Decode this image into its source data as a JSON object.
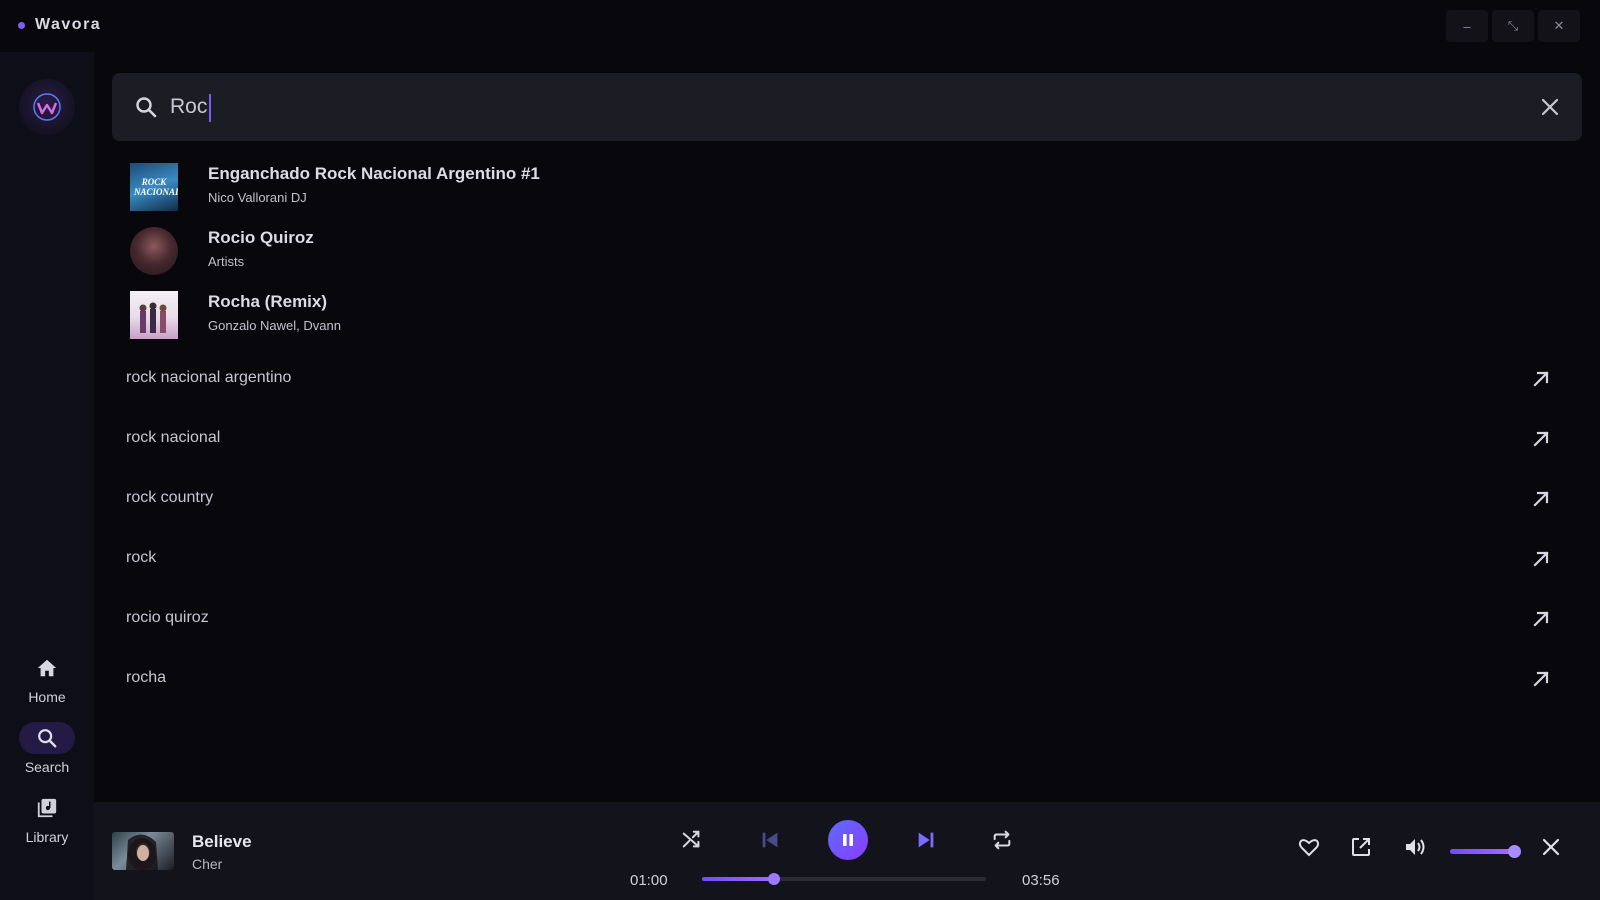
{
  "app": {
    "title": "Wavora"
  },
  "window_controls": {
    "minimize": "–",
    "restore": "⤡",
    "close": "✕"
  },
  "sidebar": {
    "items": [
      {
        "label": "Home",
        "icon": "home-icon",
        "active": false
      },
      {
        "label": "Search",
        "icon": "search-icon",
        "active": true
      },
      {
        "label": "Library",
        "icon": "library-icon",
        "active": false
      }
    ]
  },
  "search": {
    "value": "Roc",
    "placeholder": ""
  },
  "results": [
    {
      "title": "Enganchado Rock Nacional Argentino #1",
      "subtitle": "Nico Vallorani DJ",
      "thumb_text": "ROCK NACIONAL"
    },
    {
      "title": "Rocio Quiroz",
      "subtitle": "Artists"
    },
    {
      "title": "Rocha (Remix)",
      "subtitle": "Gonzalo Nawel, Dvann"
    }
  ],
  "suggestions": [
    "rock nacional argentino",
    "rock nacional",
    "rock country",
    "rock",
    "rocio quiroz",
    "rocha"
  ],
  "player": {
    "title": "Believe",
    "artist": "Cher",
    "elapsed": "01:00",
    "duration": "03:56",
    "progress": 0.255,
    "volume": 0.92
  },
  "colors": {
    "accent": "#7b5cff",
    "background": "#07070c",
    "panel": "#13131c",
    "search_bg": "#1c1c24"
  }
}
